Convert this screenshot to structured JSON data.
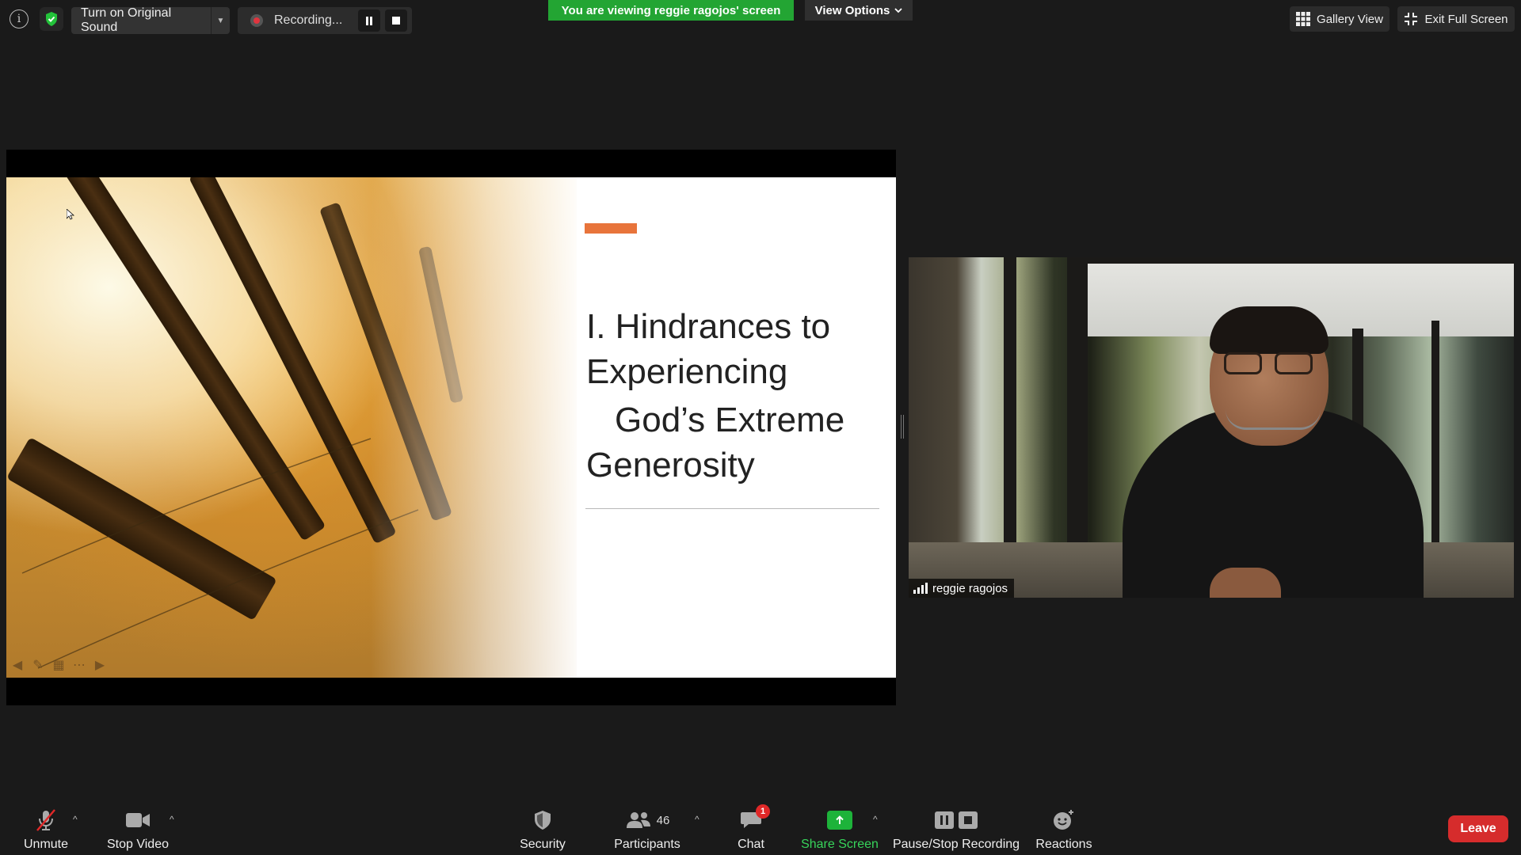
{
  "top_bar": {
    "info_icon": "info-icon",
    "security_status_icon": "shield-check-icon",
    "original_sound_label": "Turn on Original Sound",
    "recording_label": "Recording...",
    "viewing_banner": "You are viewing reggie ragojos' screen",
    "view_options_label": "View Options",
    "gallery_view_label": "Gallery View",
    "exit_full_screen_label": "Exit Full Screen"
  },
  "slide": {
    "title_line_1": "I. Hindrances to",
    "title_line_2": "Experiencing",
    "title_line_3": "God’s Extreme",
    "title_line_4": "Generosity",
    "accent_color": "#e8743b"
  },
  "video": {
    "participant_name": "reggie ragojos"
  },
  "toolbar": {
    "unmute_label": "Unmute",
    "stop_video_label": "Stop Video",
    "security_label": "Security",
    "participants_label": "Participants",
    "participants_count": "46",
    "chat_label": "Chat",
    "chat_badge": "1",
    "share_screen_label": "Share Screen",
    "pause_stop_recording_label": "Pause/Stop Recording",
    "reactions_label": "Reactions",
    "leave_label": "Leave"
  },
  "colors": {
    "banner_green": "#23a533",
    "share_green": "#1db33a",
    "leave_red": "#d62c2c",
    "badge_red": "#e02828"
  }
}
